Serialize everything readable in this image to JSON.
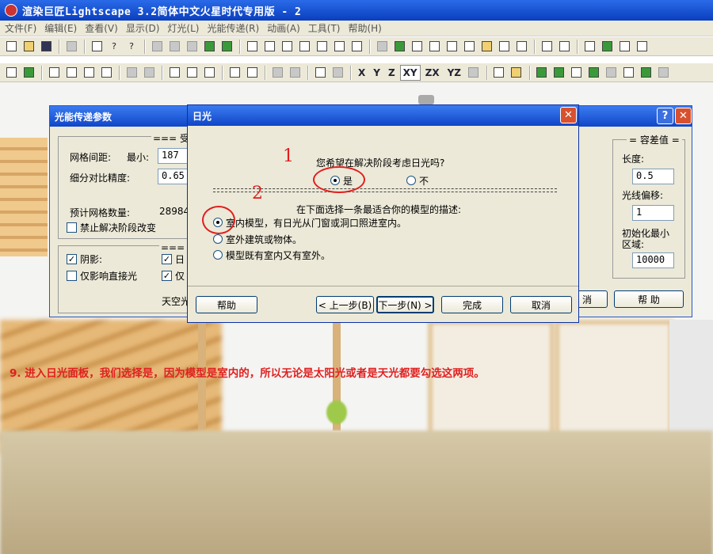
{
  "app": {
    "title": "渲染巨匠Lightscape 3.2简体中文火星时代专用版 - 2"
  },
  "menu": [
    "文件(F)",
    "编辑(E)",
    "查看(V)",
    "显示(D)",
    "灯光(L)",
    "光能传递(R)",
    "动画(A)",
    "工具(T)",
    "帮助(H)"
  ],
  "toolbar2_axes": [
    "X",
    "Y",
    "Z",
    "XY",
    "ZX",
    "YZ"
  ],
  "toolbar2_selected_axis": "XY",
  "radiosity_dialog": {
    "title": "光能传递参数",
    "group_receiver": "=== 受",
    "mesh_spacing_label": "网格间距:",
    "min_label": "最小:",
    "min_value": "187",
    "subdiv_label": "细分对比精度:",
    "subdiv_value": "0.65",
    "mesh_count_label": "预计网格数量:",
    "mesh_count_value": "28984",
    "disable_solve_label": "禁止解决阶段改变",
    "group_second": "=== 精",
    "shadow_label": "阴影:",
    "direct_only_label": "仅影响直接光",
    "cb3_label": "日",
    "cb4_label": "仅",
    "sky_label": "天空光",
    "tolerance_group": "容差值",
    "length_label": "长度:",
    "length_value": "0.5",
    "ray_offset_label": "光线偏移:",
    "ray_offset_value": "1",
    "init_min_area_label1": "初始化最小",
    "init_min_area_label2": "区域:",
    "init_min_area_value": "10000",
    "cancel_partial": "消",
    "help_label": "帮 助"
  },
  "daylight_dialog": {
    "title": "日光",
    "question": "您希望在解决阶段考虑日光吗?",
    "yes_label": "是",
    "no_label": "不",
    "yes_selected": true,
    "instruction": "在下面选择一条最适合你的模型的描述:",
    "options": [
      {
        "label": "室内模型，有日光从门窗或洞口照进室内。",
        "selected": true
      },
      {
        "label": "室外建筑或物体。",
        "selected": false
      },
      {
        "label": "模型既有室内又有室外。",
        "selected": false
      }
    ],
    "buttons": {
      "help": "帮助",
      "back": "< 上一步(B)",
      "next": "下一步(N) >",
      "finish": "完成",
      "cancel": "取消"
    }
  },
  "annotations": {
    "mark1": "1",
    "mark2": "2"
  },
  "caption": "9. 进入日光面板，我们选择是，因为模型是室内的，所以无论是太阳光或者是天光都要勾选这两项。"
}
